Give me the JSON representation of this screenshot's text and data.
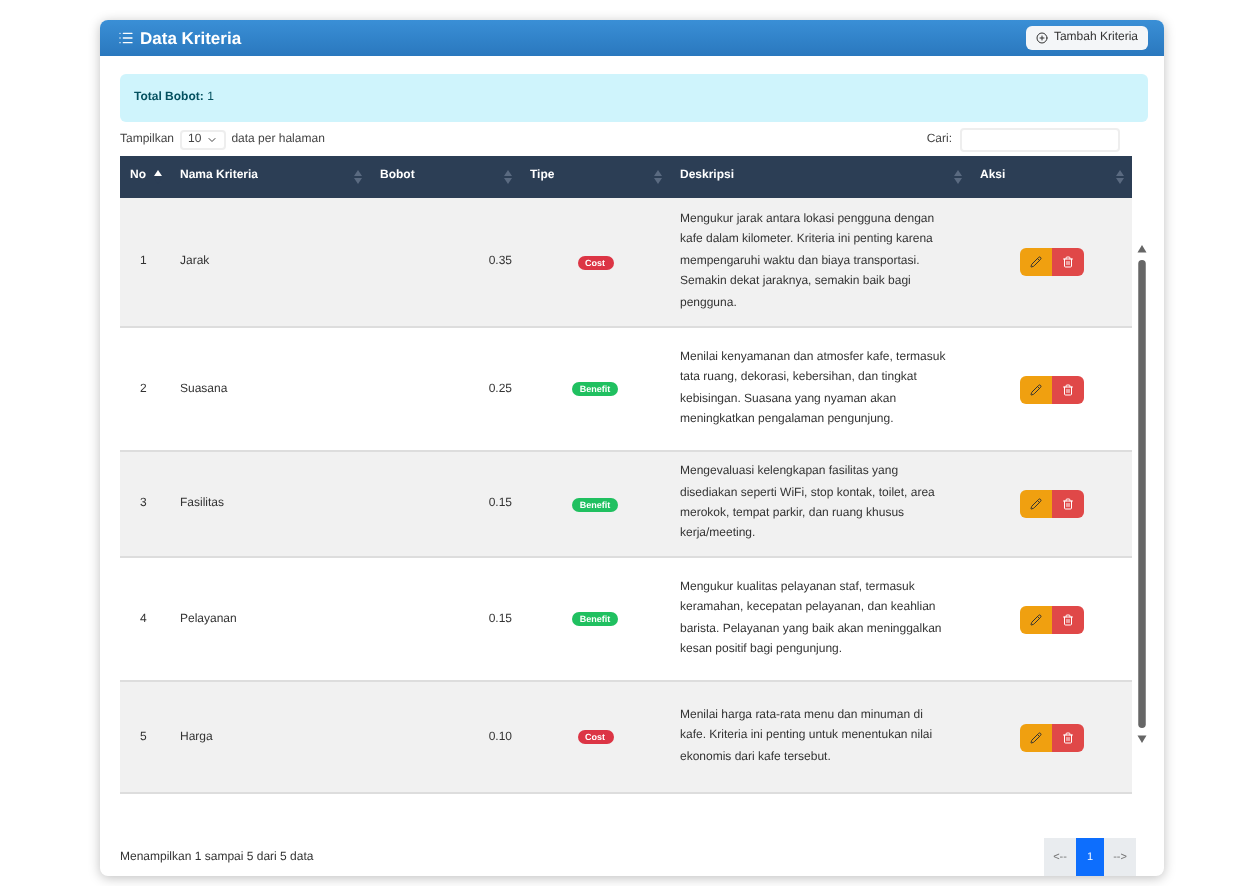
{
  "card": {
    "title": "Data Kriteria",
    "add_button": "Tambah Kriteria"
  },
  "alert": {
    "label": "Total Bobot:",
    "value": "1"
  },
  "length_control": {
    "before": "Tampilkan",
    "value": "10",
    "after": "data per halaman"
  },
  "search": {
    "label": "Cari:"
  },
  "table": {
    "columns": [
      {
        "label": "No",
        "sorted": true
      },
      {
        "label": "Nama Kriteria",
        "sorted": false
      },
      {
        "label": "Bobot",
        "sorted": false
      },
      {
        "label": "Tipe",
        "sorted": false
      },
      {
        "label": "Deskripsi",
        "sorted": false
      },
      {
        "label": "Aksi",
        "sorted": false
      }
    ],
    "rows": [
      {
        "no": "1",
        "name": "Jarak",
        "weight": "0.35",
        "type": {
          "label": "Cost",
          "kind": "cost"
        },
        "description": "Mengukur jarak antara lokasi pengguna dengan kafe dalam kilometer. Kriteria ini penting karena mempengaruhi waktu dan biaya transportasi. Semakin dekat jaraknya, semakin baik bagi pengguna."
      },
      {
        "no": "2",
        "name": "Suasana",
        "weight": "0.25",
        "type": {
          "label": "Benefit",
          "kind": "benefit"
        },
        "description": "Menilai kenyamanan dan atmosfer kafe, termasuk tata ruang, dekorasi, kebersihan, dan tingkat kebisingan. Suasana yang nyaman akan meningkatkan pengalaman pengunjung."
      },
      {
        "no": "3",
        "name": "Fasilitas",
        "weight": "0.15",
        "type": {
          "label": "Benefit",
          "kind": "benefit"
        },
        "description": "Mengevaluasi kelengkapan fasilitas yang disediakan seperti WiFi, stop kontak, toilet, area merokok, tempat parkir, dan ruang khusus kerja/meeting."
      },
      {
        "no": "4",
        "name": "Pelayanan",
        "weight": "0.15",
        "type": {
          "label": "Benefit",
          "kind": "benefit"
        },
        "description": "Mengukur kualitas pelayanan staf, termasuk keramahan, kecepatan pelayanan, dan keahlian barista. Pelayanan yang baik akan meninggalkan kesan positif bagi pengunjung."
      },
      {
        "no": "5",
        "name": "Harga",
        "weight": "0.10",
        "type": {
          "label": "Cost",
          "kind": "cost"
        },
        "description": "Menilai harga rata-rata menu dan minuman di kafe. Kriteria ini penting untuk menentukan nilai ekonomis dari kafe tersebut."
      }
    ]
  },
  "info": "Menampilkan 1 sampai 5 dari 5 data",
  "pagination": [
    {
      "label": "<--",
      "selected": false
    },
    {
      "label": "1",
      "selected": true
    },
    {
      "label": "-->",
      "selected": false
    }
  ]
}
